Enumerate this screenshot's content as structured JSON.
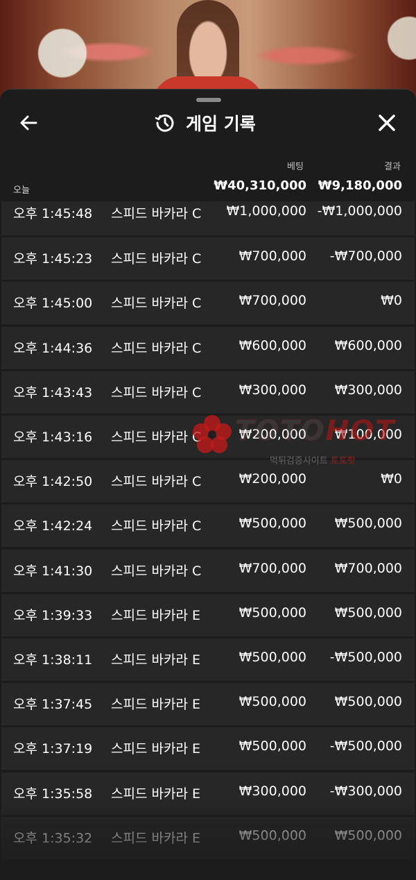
{
  "header": {
    "title": "게임 기록",
    "back_icon": "arrow-left-icon",
    "history_icon": "history-clock-icon",
    "close_icon": "close-icon"
  },
  "columns": {
    "bet": "베팅",
    "result": "결과"
  },
  "summary": {
    "label": "오늘",
    "total_bet": "₩40,310,000",
    "total_result": "₩9,180,000"
  },
  "rows": [
    {
      "time": "오후 1:45:48",
      "game": "스피드 바카라 C",
      "bet": "₩1,000,000",
      "result": "-₩1,000,000"
    },
    {
      "time": "오후 1:45:23",
      "game": "스피드 바카라 C",
      "bet": "₩700,000",
      "result": "-₩700,000"
    },
    {
      "time": "오후 1:45:00",
      "game": "스피드 바카라 C",
      "bet": "₩700,000",
      "result": "₩0"
    },
    {
      "time": "오후 1:44:36",
      "game": "스피드 바카라 C",
      "bet": "₩600,000",
      "result": "₩600,000"
    },
    {
      "time": "오후 1:43:43",
      "game": "스피드 바카라 C",
      "bet": "₩300,000",
      "result": "₩300,000"
    },
    {
      "time": "오후 1:43:16",
      "game": "스피드 바카라 C",
      "bet": "₩200,000",
      "result": "₩100,000"
    },
    {
      "time": "오후 1:42:50",
      "game": "스피드 바카라 C",
      "bet": "₩200,000",
      "result": "₩0"
    },
    {
      "time": "오후 1:42:24",
      "game": "스피드 바카라 C",
      "bet": "₩500,000",
      "result": "₩500,000"
    },
    {
      "time": "오후 1:41:30",
      "game": "스피드 바카라 C",
      "bet": "₩700,000",
      "result": "₩700,000"
    },
    {
      "time": "오후 1:39:33",
      "game": "스피드 바카라 E",
      "bet": "₩500,000",
      "result": "₩500,000"
    },
    {
      "time": "오후 1:38:11",
      "game": "스피드 바카라 E",
      "bet": "₩500,000",
      "result": "-₩500,000"
    },
    {
      "time": "오후 1:37:45",
      "game": "스피드 바카라 E",
      "bet": "₩500,000",
      "result": "₩500,000"
    },
    {
      "time": "오후 1:37:19",
      "game": "스피드 바카라 E",
      "bet": "₩500,000",
      "result": "-₩500,000"
    },
    {
      "time": "오후 1:35:58",
      "game": "스피드 바카라 E",
      "bet": "₩300,000",
      "result": "-₩300,000"
    },
    {
      "time": "오후 1:35:32",
      "game": "스피드 바카라 E",
      "bet": "₩500,000",
      "result": "₩500,000"
    }
  ],
  "watermark": {
    "brand_a": "TOTO",
    "brand_b": "HOT",
    "sub_a": "먹튀검증사이트 ",
    "sub_b": "토토핫"
  },
  "colors": {
    "sheet": "#1c1c1c",
    "row": "#272727",
    "text": "#ffffff",
    "muted": "#bdbdbd"
  }
}
